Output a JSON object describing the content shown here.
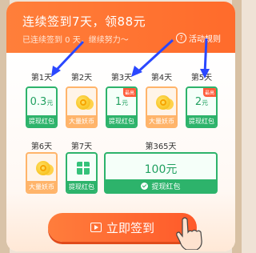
{
  "header": {
    "title": "连续签到7天，领88元",
    "subtitle": "已连续签到 0 天，继续努力～",
    "rules_label": "活动规则"
  },
  "days_row1": [
    {
      "day": "第1天",
      "type": "cash",
      "amount": "0.3",
      "unit": "元",
      "footer": "提现红包",
      "tag": ""
    },
    {
      "day": "第2天",
      "type": "coins",
      "footer": "大量妖币"
    },
    {
      "day": "第3天",
      "type": "cash",
      "amount": "1",
      "unit": "元",
      "footer": "提现红包",
      "tag": "最高"
    },
    {
      "day": "第4天",
      "type": "coins",
      "footer": "大量妖币"
    },
    {
      "day": "第5天",
      "type": "cash",
      "amount": "2",
      "unit": "元",
      "footer": "提现红包",
      "tag": "最高"
    }
  ],
  "days_row2": [
    {
      "day": "第6天",
      "type": "coins",
      "footer": "大量妖币"
    },
    {
      "day": "第7天",
      "type": "gift",
      "footer": "提现红包"
    }
  ],
  "big_reward": {
    "day": "第365天",
    "amount": "100元",
    "footer": "提现红包"
  },
  "cta_label": "立即签到",
  "colors": {
    "accent": "#ff6b2b",
    "green": "#2db36b",
    "orange": "#ffb46a"
  }
}
